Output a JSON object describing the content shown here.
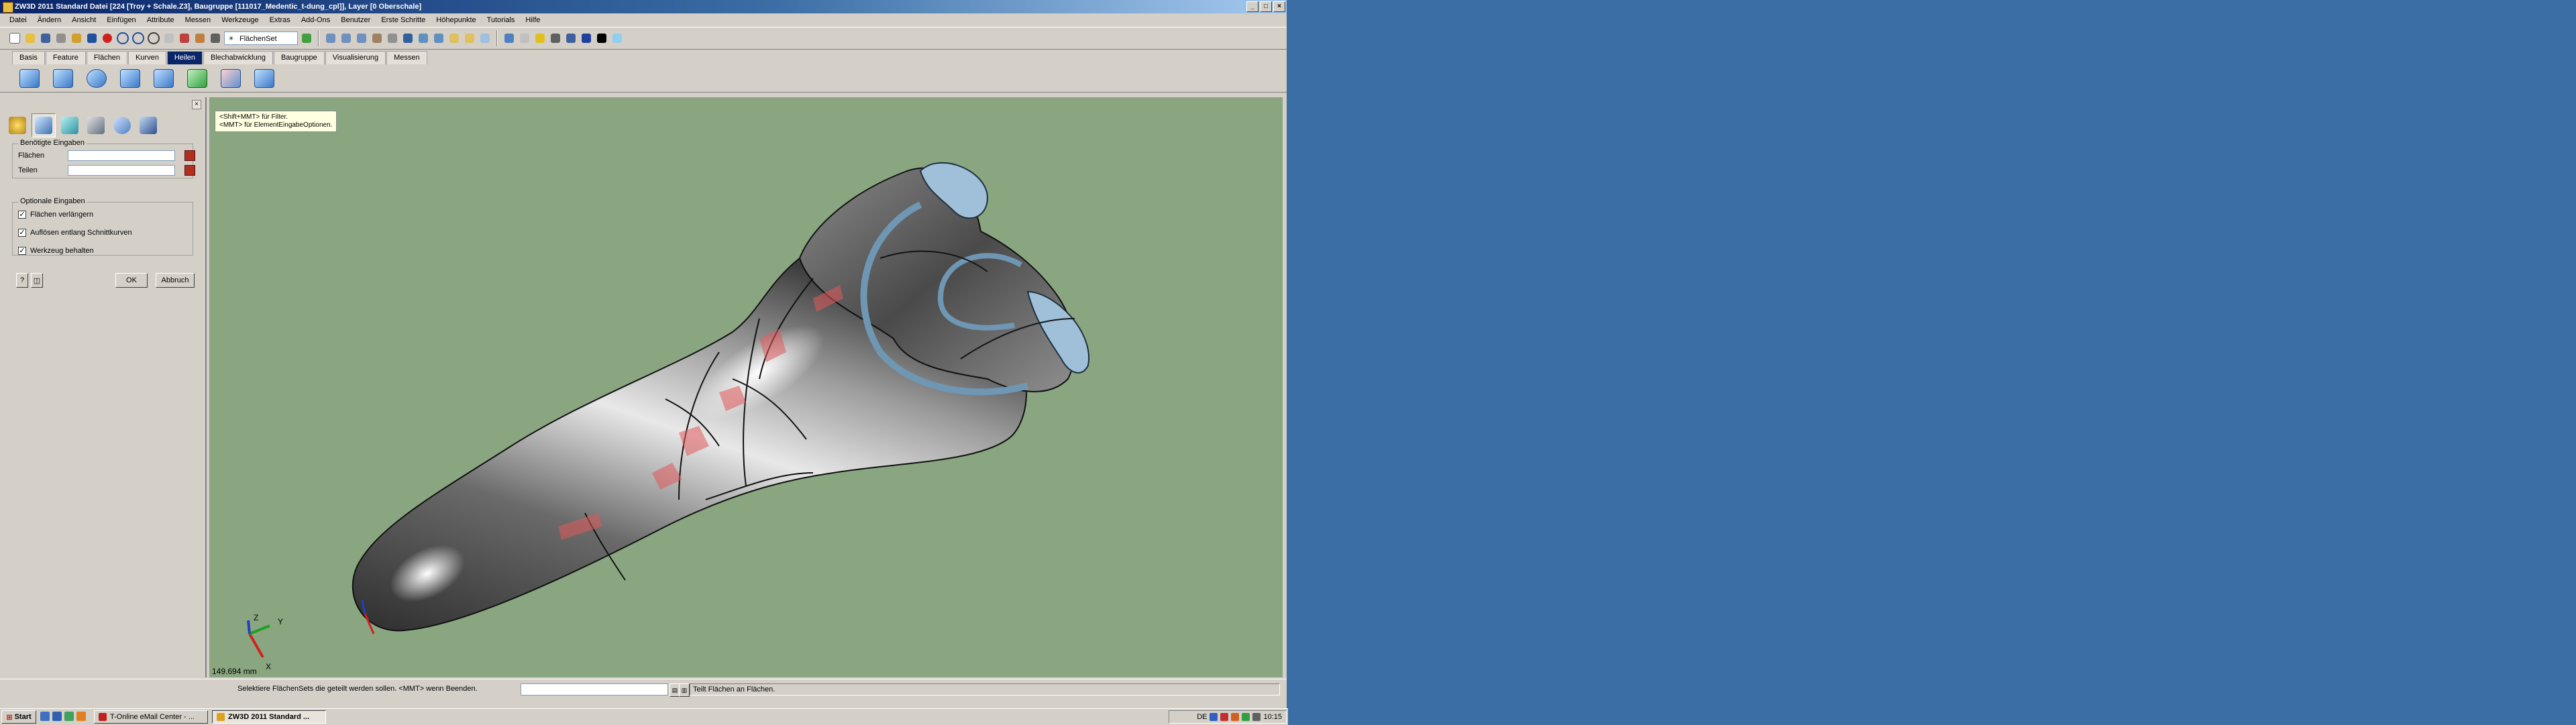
{
  "window": {
    "title": "ZW3D 2011 Standard    Datei [224 [Troy + Schale.Z3], Baugruppe [111017_Medentic_t-dung_cpl]], Layer [0 Oberschale]"
  },
  "menu": [
    "Datei",
    "Ändern",
    "Ansicht",
    "Einfügen",
    "Attribute",
    "Messen",
    "Werkzeuge",
    "Extras",
    "Add-Ons",
    "Benutzer",
    "Erste Schritte",
    "Höhepunkte",
    "Tutorials",
    "Hilfe"
  ],
  "toolbar": {
    "filter_value": "FlächenSet"
  },
  "ribbon_tabs": [
    {
      "label": "Basis",
      "active": false
    },
    {
      "label": "Feature",
      "active": false
    },
    {
      "label": "Flächen",
      "active": false
    },
    {
      "label": "Kurven",
      "active": false
    },
    {
      "label": "Heilen",
      "active": true
    },
    {
      "label": "Blechabwicklung",
      "active": false
    },
    {
      "label": "Baugruppe",
      "active": false
    },
    {
      "label": "Visualisierung",
      "active": false
    },
    {
      "label": "Messen",
      "active": false
    }
  ],
  "panel": {
    "required_title": "Benötigte Eingaben",
    "field_faces_label": "Flächen",
    "field_faces_value": "",
    "field_parts_label": "Teilen",
    "field_parts_value": "",
    "optional_title": "Optionale Eingaben",
    "options": [
      {
        "label": "Flächen verlängern",
        "checked": true
      },
      {
        "label": "Auflösen entlang Schnittkurven",
        "checked": true
      },
      {
        "label": "Werkzeug behalten",
        "checked": true
      }
    ],
    "ok_label": "OK",
    "cancel_label": "Abbruch"
  },
  "viewport": {
    "tooltip_line1": "<Shift+MMT> für Filter.",
    "tooltip_line2": "<MMT> für ElementEingabeOptionen.",
    "scale": "149.694 mm",
    "axis_x": "X",
    "axis_y": "Y",
    "axis_z": "Z",
    "background": "#8aa681"
  },
  "status": {
    "prompt": "Selektiere FlächenSets die geteilt werden sollen.  <MMT> wenn Beenden.",
    "info": "Teilt Flächen an Flächen."
  },
  "taskbar": {
    "start_label": "Start",
    "tasks": [
      {
        "label": "T-Online eMail Center - ...",
        "active": false
      },
      {
        "label": "ZW3D 2011 Standard ...",
        "active": true
      }
    ],
    "language": "DE",
    "clock": "10:15"
  }
}
